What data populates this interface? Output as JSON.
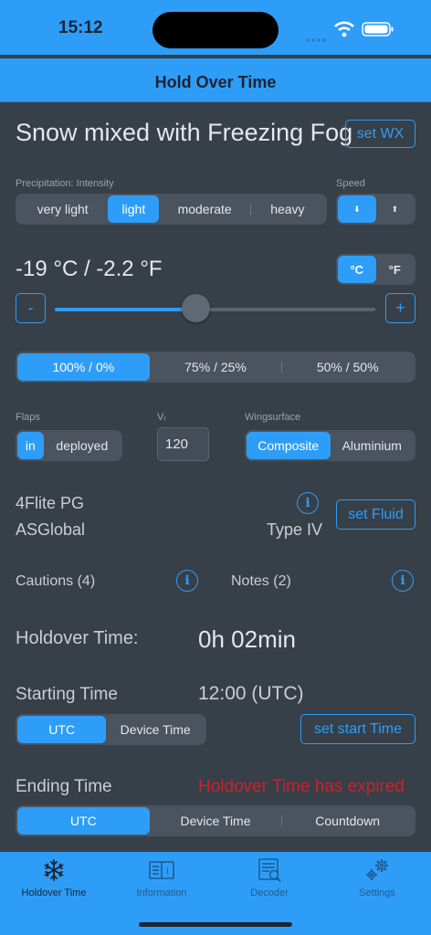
{
  "status": {
    "time": "15:12"
  },
  "nav": {
    "title": "Hold Over Time"
  },
  "weather": {
    "title": "Snow mixed with Freezing Fog",
    "set_wx": "set WX"
  },
  "precip": {
    "label": "Precipitation: Intensity",
    "options": [
      "very light",
      "light",
      "moderate",
      "heavy"
    ],
    "selected": "light"
  },
  "speed": {
    "label": "Speed",
    "options": [
      "⬇",
      "⬆"
    ],
    "selected": "⬇"
  },
  "temperature": {
    "value": "-19 °C / -2.2 °F",
    "units": [
      "°C",
      "°F"
    ],
    "selected_unit": "°C",
    "minus": "-",
    "plus": "+",
    "slider_fraction": 0.44
  },
  "mix": {
    "options": [
      "100% / 0%",
      "75% / 25%",
      "50% / 50%"
    ],
    "selected": "100% / 0%"
  },
  "flaps": {
    "label": "Flaps",
    "options": [
      "in",
      "deployed"
    ],
    "selected": "in"
  },
  "vr": {
    "label": "Vᵣ",
    "value": "120"
  },
  "wingsurface": {
    "label": "Wingsurface",
    "options": [
      "Composite",
      "Aluminium"
    ],
    "selected": "Composite"
  },
  "fluid": {
    "name": "4Flite PG",
    "maker": "ASGlobal",
    "type": "Type IV",
    "set_fluid": "set Fluid",
    "info": "i"
  },
  "cautions": {
    "label": "Cautions (4)",
    "info": "i"
  },
  "notes": {
    "label": "Notes (2)",
    "info": "i"
  },
  "holdover": {
    "label": "Holdover Time:",
    "value": "0h 02min"
  },
  "starting": {
    "label": "Starting Time",
    "value": "12:00 (UTC)",
    "options": [
      "UTC",
      "Device Time"
    ],
    "selected": "UTC",
    "set_start": "set start Time"
  },
  "ending": {
    "label": "Ending Time",
    "status": "Holdover Time has expired",
    "options": [
      "UTC",
      "Device Time",
      "Countdown"
    ],
    "selected": "UTC"
  },
  "tabs": [
    {
      "label": "Holdover Time",
      "icon": "snowflake-icon",
      "active": true
    },
    {
      "label": "Information",
      "icon": "book-icon",
      "active": false
    },
    {
      "label": "Decoder",
      "icon": "decoder-icon",
      "active": false
    },
    {
      "label": "Settings",
      "icon": "gears-icon",
      "active": false
    }
  ],
  "colors": {
    "accent": "#2e9df8",
    "background": "#373f49",
    "expired": "#c8242c"
  }
}
